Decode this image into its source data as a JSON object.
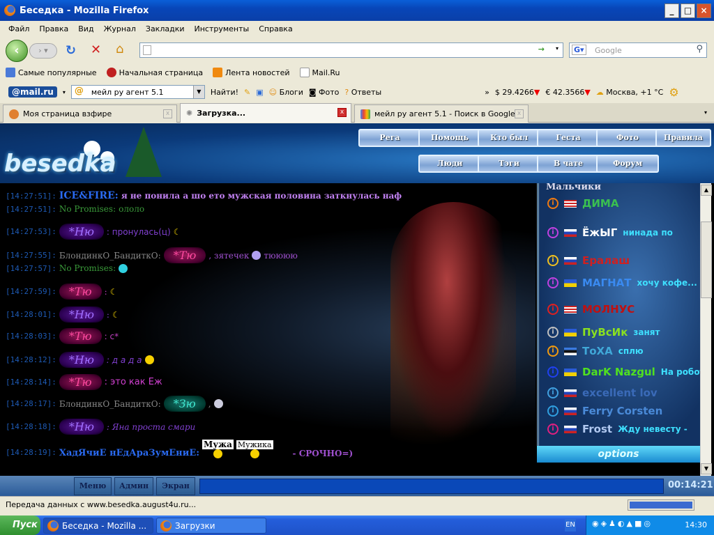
{
  "window": {
    "title": "Беседка - Mozilla Firefox"
  },
  "menu": [
    "Файл",
    "Правка",
    "Вид",
    "Журнал",
    "Закладки",
    "Инструменты",
    "Справка"
  ],
  "nav": {
    "url": "",
    "search_placeholder": "Google"
  },
  "bookmarks": [
    "Самые популярные",
    "Начальная страница",
    "Лента новостей",
    "Mail.Ru"
  ],
  "mailru_bar": {
    "logo": "@mail.ru",
    "search_value": "мейл ру агент 5.1",
    "find": "Найти!",
    "blogs": "Блоги",
    "photo": "Фото",
    "answers": "Ответы",
    "more": "»",
    "usd": "$ 29.4266",
    "eur": "€ 42.3566",
    "weather": "Москва, +1 °C"
  },
  "tabs": [
    {
      "label": "Моя страница взфире"
    },
    {
      "label": "Загрузка...",
      "active": true
    },
    {
      "label": "мейл ру агент 5.1 - Поиск в Google"
    }
  ],
  "site": {
    "logo": "besedka",
    "nav_top": [
      "Рега",
      "Помощь",
      "Кто был",
      "Геста",
      "Фото",
      "Правила"
    ],
    "nav_bottom": [
      "Люди",
      "Тэги",
      "В чате",
      "Форум"
    ]
  },
  "chat": [
    {
      "time": "[14:27:51]:",
      "nick": "ICE&FIRE:",
      "text": "я не понила а шо ето мужская половина заткнулась наф",
      "style": "ice"
    },
    {
      "time": "[14:27:51]:",
      "nick": "No Promises:",
      "text": "ололо",
      "style": "np"
    },
    {
      "time": "[14:27:53]:",
      "nick": "*Ню",
      "text": ": пронулась(ц)",
      "style": "purple"
    },
    {
      "time": "[14:27:55]:",
      "nick": "БлондинкО_БандиткО:",
      "nick2": "*Тю",
      "text": ", зятечек",
      "text2": "тюююю",
      "style": "blond-pink"
    },
    {
      "time": "[14:27:57]:",
      "nick": "No Promises:",
      "text": "",
      "style": "np"
    },
    {
      "time": "[14:27:59]:",
      "nick": "*Тю",
      "text": ":",
      "style": "pink"
    },
    {
      "time": "[14:28:01]:",
      "nick": "*Ню",
      "text": ":",
      "style": "purple"
    },
    {
      "time": "[14:28:03]:",
      "nick": "*Тю",
      "text": ": с*",
      "style": "pink"
    },
    {
      "time": "[14:28:12]:",
      "nick": "*Ню",
      "text": ": д а д а",
      "style": "purple"
    },
    {
      "time": "[14:28:14]:",
      "nick": "*Тю",
      "text": ": это как Еж",
      "style": "pink"
    },
    {
      "time": "[14:28:17]:",
      "nick": "БлондинкО_БандиткО:",
      "nick2": "*Зю",
      "text": ",",
      "style": "blond-teal"
    },
    {
      "time": "[14:28:18]:",
      "nick": "*Ню",
      "text": ": Яна проста смари",
      "style": "purple"
    },
    {
      "time": "[14:28:19]:",
      "nick": "ХадЯчиЕ нЕдАраЗумЕниЕ:",
      "sign1": "Мужа",
      "sign2": "Мужика",
      "text": "- СРОЧНО=)",
      "style": "had"
    }
  ],
  "userlist": {
    "header": "Мальчики",
    "users": [
      {
        "name": "ДИМА",
        "flag": "us",
        "status_color": "#f07a10",
        "name_color": "#3ac050",
        "status": ""
      },
      {
        "name": "ЁжЫГ",
        "flag": "ru",
        "status_color": "#c040e0",
        "name_color": "#ffffff",
        "status": "нинада по"
      },
      {
        "name": "Ералаш",
        "flag": "ru",
        "status_color": "#f0c020",
        "name_color": "#d02020",
        "status": ""
      },
      {
        "name": "МАГНАТ",
        "flag": "ua",
        "status_color": "#c040e0",
        "name_color": "#3a8af0",
        "status": "хочу кофе..."
      },
      {
        "name": "МОЛНУС",
        "flag": "us",
        "status_color": "#e02020",
        "name_color": "#c01010",
        "status": ""
      },
      {
        "name": "ПуВсИк",
        "flag": "ua",
        "status_color": "#c0c0c0",
        "name_color": "#8ae020",
        "status": "занят"
      },
      {
        "name": "ТоХА",
        "flag": "ee",
        "status_color": "#f09a10",
        "name_color": "#40a8d8",
        "status": "сплю"
      },
      {
        "name": "DarK Nazgul",
        "flag": "ua",
        "status_color": "#2040f0",
        "name_color": "#50e020",
        "status": "На роботе"
      },
      {
        "name": "excellent lov",
        "flag": "ru",
        "status_color": "#40a0e0",
        "name_color": "#3a6ab8",
        "status": ""
      },
      {
        "name": "Ferry Corsten",
        "flag": "ru",
        "status_color": "#30a0e0",
        "name_color": "#4a8ad8",
        "status": ""
      },
      {
        "name": "Frost",
        "flag": "ru",
        "status_color": "#e02080",
        "name_color": "#b0c8f0",
        "status": "Жду невесту -"
      }
    ],
    "options": "options"
  },
  "chatbar": {
    "buttons": [
      "Меню",
      "Админ",
      "Экран"
    ],
    "clock": "00:14:21"
  },
  "status": {
    "text": "Передача данных с www.besedka.august4u.ru..."
  },
  "taskbar": {
    "start": "Пуск",
    "tasks": [
      "Беседка - Mozilla ...",
      "Загрузки"
    ],
    "lang": "EN",
    "time": "14:30"
  }
}
